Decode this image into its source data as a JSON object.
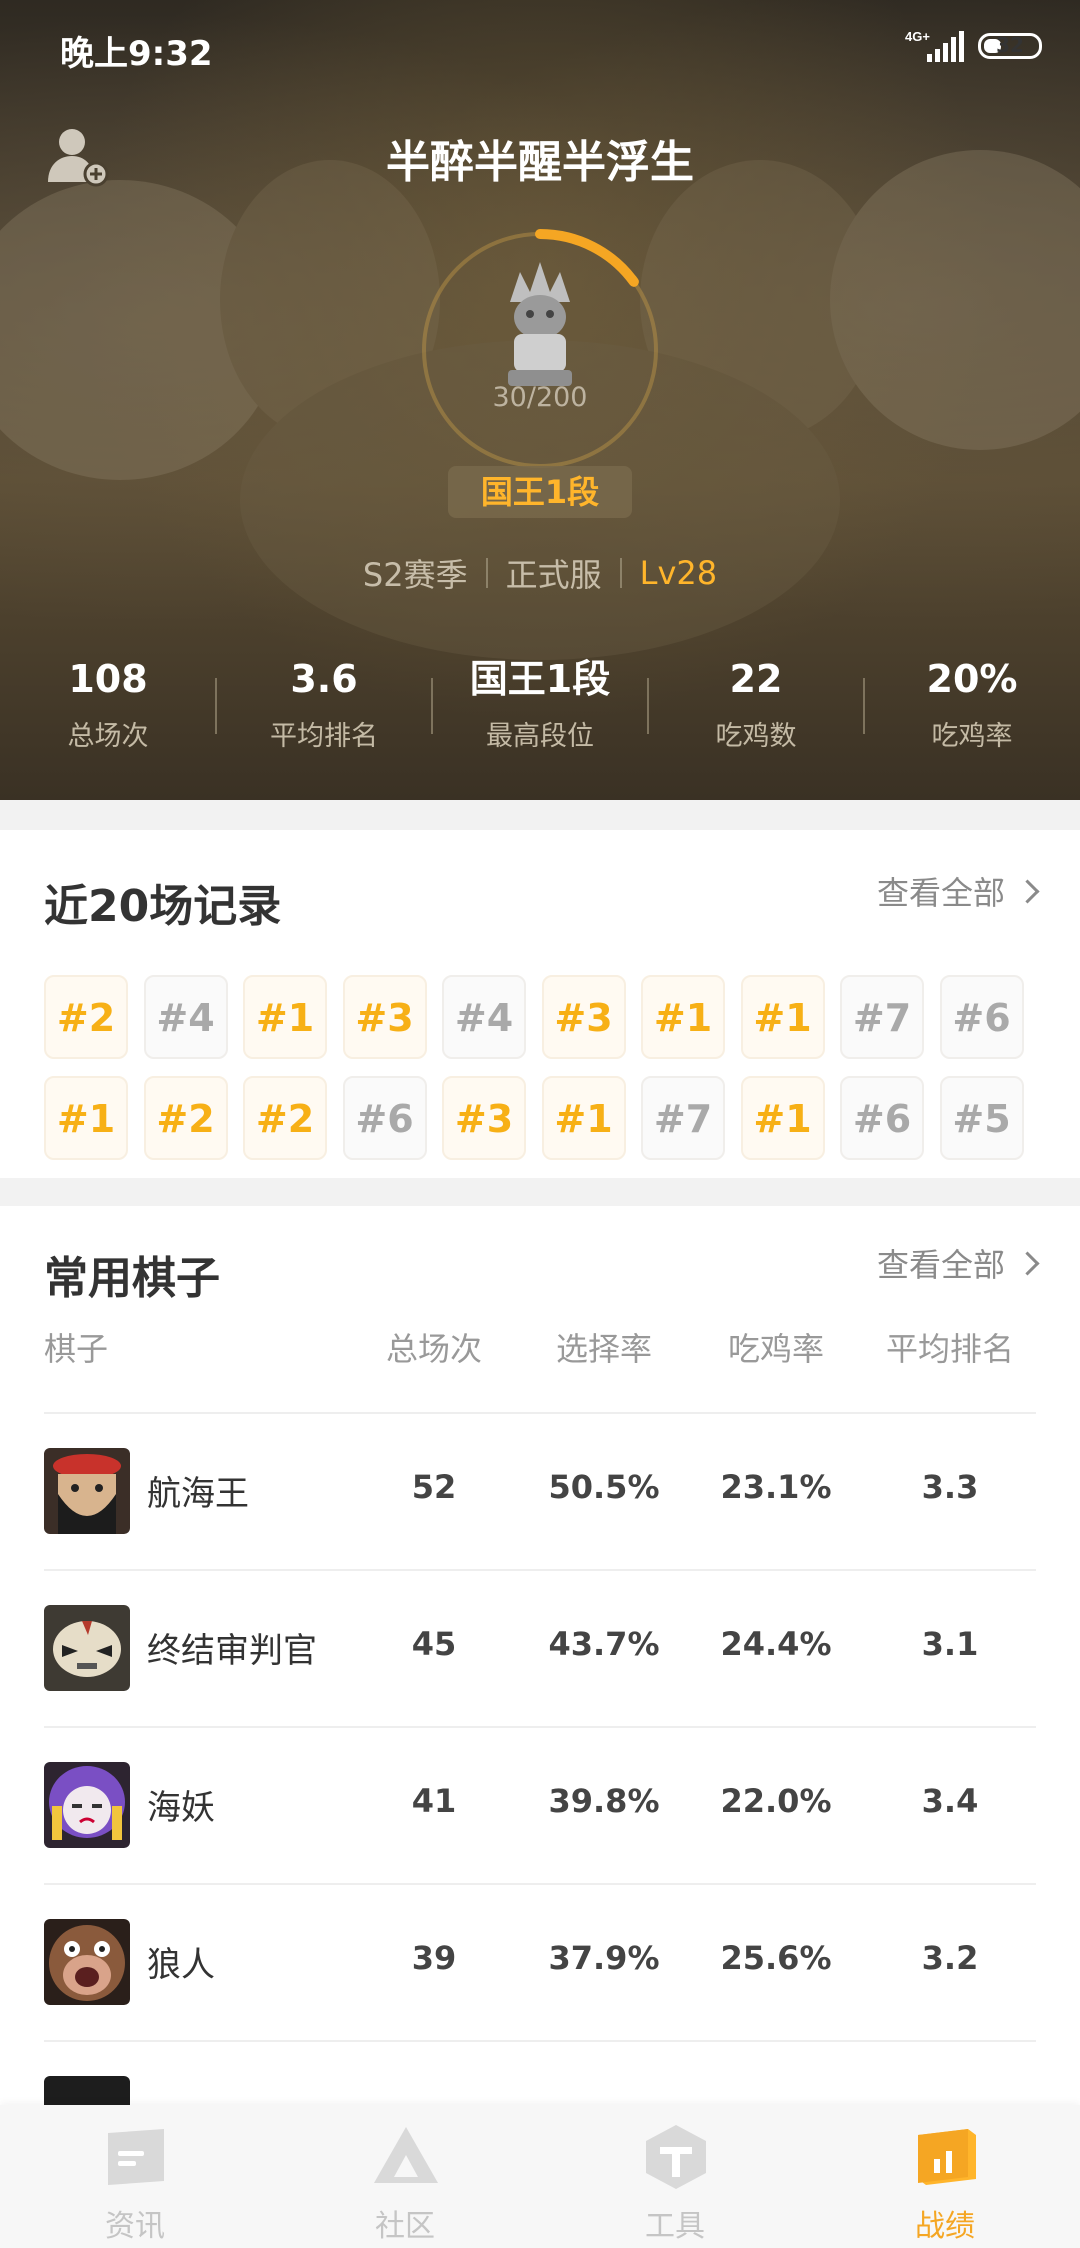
{
  "status_bar": {
    "time": "晚上9:32",
    "network": "4G+",
    "battery": "32"
  },
  "profile": {
    "nickname": "半醉半醒半浮生",
    "rank_progress": "30/200",
    "rank_progress_fraction": 0.15,
    "tier": "国王1段",
    "season": "S2赛季",
    "server": "正式服",
    "level": "Lv28"
  },
  "stats": [
    {
      "value": "108",
      "label": "总场次"
    },
    {
      "value": "3.6",
      "label": "平均排名"
    },
    {
      "value": "国王1段",
      "label": "最高段位"
    },
    {
      "value": "22",
      "label": "吃鸡数"
    },
    {
      "value": "20%",
      "label": "吃鸡率"
    }
  ],
  "recent": {
    "title": "近20场记录",
    "view_all": "查看全部",
    "results": [
      "#2",
      "#4",
      "#1",
      "#3",
      "#4",
      "#3",
      "#1",
      "#1",
      "#7",
      "#6",
      "#1",
      "#2",
      "#2",
      "#6",
      "#3",
      "#1",
      "#7",
      "#1",
      "#6",
      "#5"
    ],
    "highlight_color": "#f7b016",
    "normal_color": "#a9a9a9"
  },
  "pieces": {
    "title": "常用棋子",
    "view_all": "查看全部",
    "headers": [
      "棋子",
      "总场次",
      "选择率",
      "吃鸡率",
      "平均排名"
    ],
    "rows": [
      {
        "name": "航海王",
        "games": "52",
        "pick_rate": "50.5%",
        "win_rate": "23.1%",
        "avg_rank": "3.3"
      },
      {
        "name": "终结审判官",
        "games": "45",
        "pick_rate": "43.7%",
        "win_rate": "24.4%",
        "avg_rank": "3.1"
      },
      {
        "name": "海妖",
        "games": "41",
        "pick_rate": "39.8%",
        "win_rate": "22.0%",
        "avg_rank": "3.4"
      },
      {
        "name": "狼人",
        "games": "39",
        "pick_rate": "37.9%",
        "win_rate": "25.6%",
        "avg_rank": "3.2"
      }
    ]
  },
  "nav": [
    {
      "label": "资讯",
      "icon": "news-icon"
    },
    {
      "label": "社区",
      "icon": "community-icon"
    },
    {
      "label": "工具",
      "icon": "tools-icon"
    },
    {
      "label": "战绩",
      "icon": "record-icon",
      "active": true
    }
  ],
  "colors": {
    "accent": "#f5a623",
    "gold_text": "#ffb52b"
  }
}
